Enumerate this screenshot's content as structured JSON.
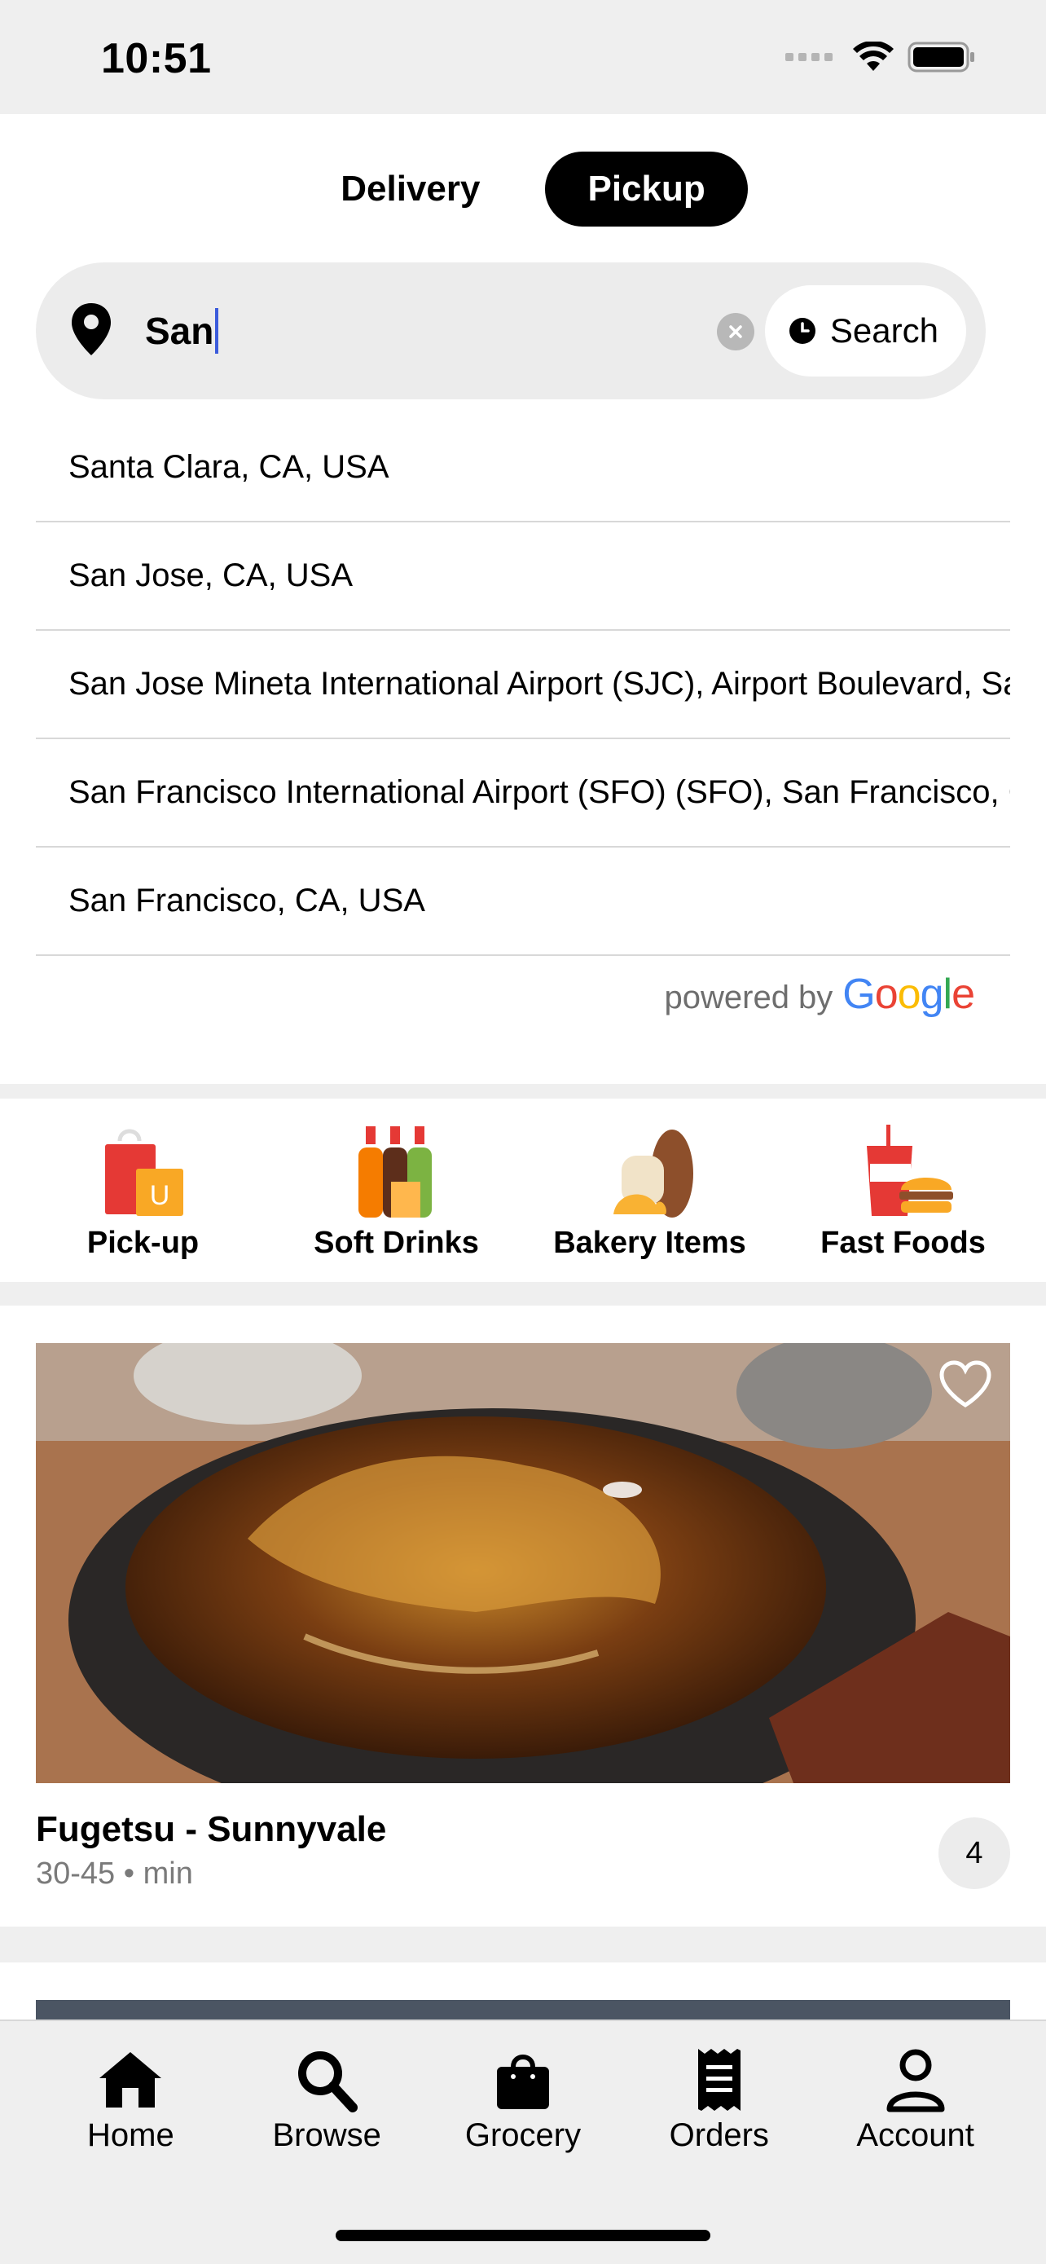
{
  "status_bar": {
    "time": "10:51"
  },
  "mode_toggle": {
    "delivery_label": "Delivery",
    "pickup_label": "Pickup",
    "selected": "Pickup"
  },
  "search": {
    "value": "San",
    "schedule_label": "Search"
  },
  "suggestions": [
    "Santa Clara, CA, USA",
    "San Jose, CA, USA",
    "San Jose Mineta International Airport (SJC), Airport Boulevard, San Jose, CA, USA",
    "San Francisco International Airport (SFO) (SFO), San Francisco, CA, USA",
    "San Francisco, CA, USA"
  ],
  "attribution": {
    "powered_by": "powered by",
    "brand": "Google"
  },
  "categories": [
    {
      "label": "Pick-up",
      "icon": "shopping-bags-icon"
    },
    {
      "label": "Soft Drinks",
      "icon": "soda-bottles-icon"
    },
    {
      "label": "Bakery Items",
      "icon": "bread-icon"
    },
    {
      "label": "Fast Foods",
      "icon": "burger-drink-icon"
    }
  ],
  "feed": {
    "restaurant_name": "Fugetsu - Sunnyvale",
    "delivery_time": "30-45 • min",
    "rating": "4"
  },
  "tab_bar": [
    {
      "label": "Home",
      "icon": "home-icon"
    },
    {
      "label": "Browse",
      "icon": "search-icon"
    },
    {
      "label": "Grocery",
      "icon": "shopping-bag-icon"
    },
    {
      "label": "Orders",
      "icon": "receipt-icon"
    },
    {
      "label": "Account",
      "icon": "person-icon"
    }
  ],
  "colors": {
    "accent": "#000000",
    "caret": "#3b5bdb",
    "background": "#efefef"
  }
}
